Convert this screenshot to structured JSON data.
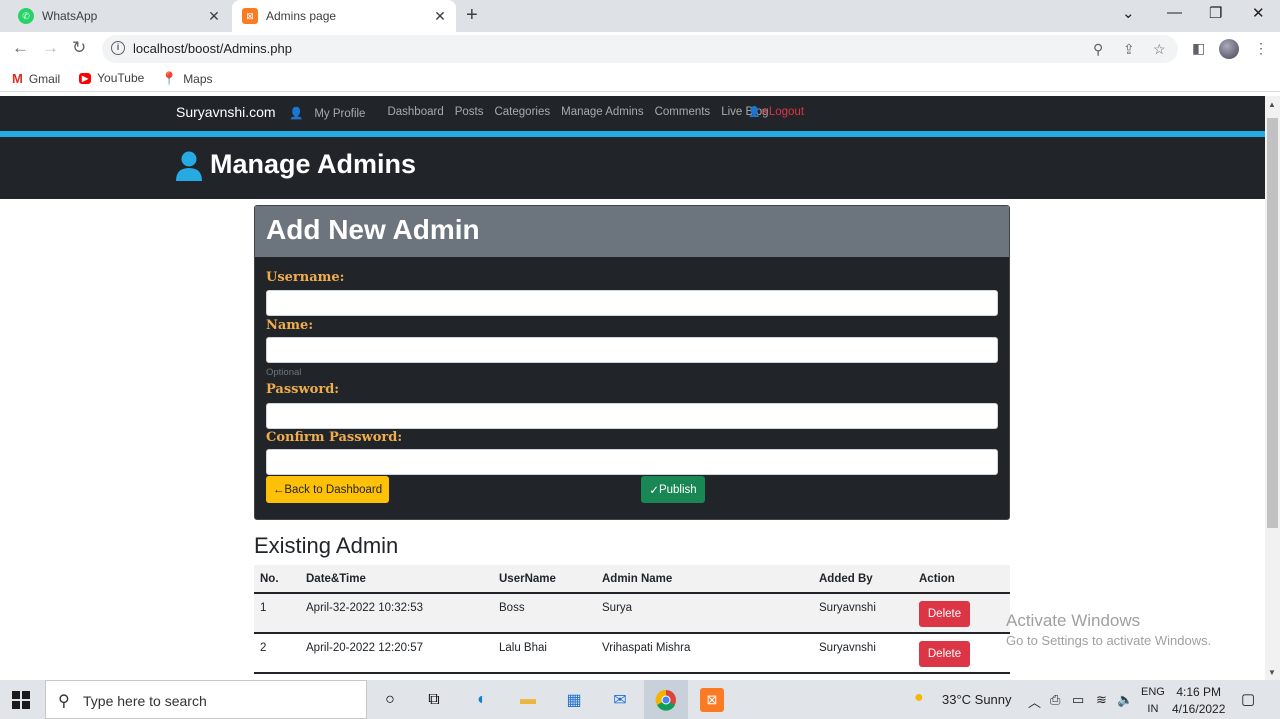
{
  "browser": {
    "tabs": [
      {
        "title": "WhatsApp",
        "active": false
      },
      {
        "title": "Admins page",
        "active": true
      }
    ],
    "url": "localhost/boost/Admins.php",
    "bookmarks": [
      "Gmail",
      "YouTube",
      "Maps"
    ]
  },
  "site": {
    "brand": "Suryavnshi.com",
    "nav": [
      "My Profile",
      "Dashboard",
      "Posts",
      "Categories",
      "Manage Admins",
      "Comments",
      "Live Blog"
    ],
    "logout": "Logout",
    "page_title": "Manage Admins"
  },
  "form": {
    "title": "Add New Admin",
    "username_label": "Username:",
    "name_label": "Name:",
    "name_hint": "Optional",
    "password_label": "Password:",
    "confirm_label": "Confirm Password:",
    "back_button": "Back to Dashboard",
    "publish_button": "Publish"
  },
  "admins": {
    "heading": "Existing Admin",
    "columns": [
      "No.",
      "Date&Time",
      "UserName",
      "Admin Name",
      "Added By",
      "Action"
    ],
    "rows": [
      {
        "no": "1",
        "datetime": "April-32-2022 10:32:53",
        "username": "Boss",
        "admin_name": "Surya",
        "added_by": "Suryavnshi",
        "action": "Delete"
      },
      {
        "no": "2",
        "datetime": "April-20-2022 12:20:57",
        "username": "Lalu Bhai",
        "admin_name": "Vrihaspati Mishra",
        "added_by": "Suryavnshi",
        "action": "Delete"
      }
    ]
  },
  "watermark": {
    "line1": "Activate Windows",
    "line2": "Go to Settings to activate Windows."
  },
  "taskbar": {
    "search_placeholder": "Type here to search",
    "weather": "33°C  Sunny",
    "lang_top": "ENG",
    "lang_bottom": "IN",
    "time": "4:16 PM",
    "date": "4/16/2022"
  },
  "colors": {
    "navbar": "#212529",
    "accent_blue": "#27aae1",
    "label_orange": "#f0ad4e",
    "warning": "#ffc107",
    "success": "#198754",
    "danger": "#dc3545"
  }
}
